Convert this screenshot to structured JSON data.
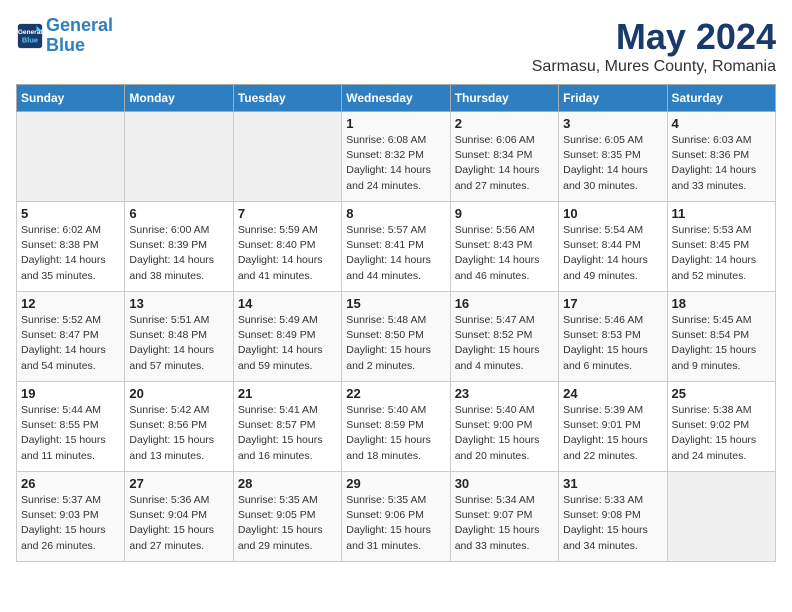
{
  "header": {
    "logo_line1": "General",
    "logo_line2": "Blue",
    "main_title": "May 2024",
    "subtitle": "Sarmasu, Mures County, Romania"
  },
  "weekdays": [
    "Sunday",
    "Monday",
    "Tuesday",
    "Wednesday",
    "Thursday",
    "Friday",
    "Saturday"
  ],
  "weeks": [
    [
      {
        "day": "",
        "detail": ""
      },
      {
        "day": "",
        "detail": ""
      },
      {
        "day": "",
        "detail": ""
      },
      {
        "day": "1",
        "detail": "Sunrise: 6:08 AM\nSunset: 8:32 PM\nDaylight: 14 hours\nand 24 minutes."
      },
      {
        "day": "2",
        "detail": "Sunrise: 6:06 AM\nSunset: 8:34 PM\nDaylight: 14 hours\nand 27 minutes."
      },
      {
        "day": "3",
        "detail": "Sunrise: 6:05 AM\nSunset: 8:35 PM\nDaylight: 14 hours\nand 30 minutes."
      },
      {
        "day": "4",
        "detail": "Sunrise: 6:03 AM\nSunset: 8:36 PM\nDaylight: 14 hours\nand 33 minutes."
      }
    ],
    [
      {
        "day": "5",
        "detail": "Sunrise: 6:02 AM\nSunset: 8:38 PM\nDaylight: 14 hours\nand 35 minutes."
      },
      {
        "day": "6",
        "detail": "Sunrise: 6:00 AM\nSunset: 8:39 PM\nDaylight: 14 hours\nand 38 minutes."
      },
      {
        "day": "7",
        "detail": "Sunrise: 5:59 AM\nSunset: 8:40 PM\nDaylight: 14 hours\nand 41 minutes."
      },
      {
        "day": "8",
        "detail": "Sunrise: 5:57 AM\nSunset: 8:41 PM\nDaylight: 14 hours\nand 44 minutes."
      },
      {
        "day": "9",
        "detail": "Sunrise: 5:56 AM\nSunset: 8:43 PM\nDaylight: 14 hours\nand 46 minutes."
      },
      {
        "day": "10",
        "detail": "Sunrise: 5:54 AM\nSunset: 8:44 PM\nDaylight: 14 hours\nand 49 minutes."
      },
      {
        "day": "11",
        "detail": "Sunrise: 5:53 AM\nSunset: 8:45 PM\nDaylight: 14 hours\nand 52 minutes."
      }
    ],
    [
      {
        "day": "12",
        "detail": "Sunrise: 5:52 AM\nSunset: 8:47 PM\nDaylight: 14 hours\nand 54 minutes."
      },
      {
        "day": "13",
        "detail": "Sunrise: 5:51 AM\nSunset: 8:48 PM\nDaylight: 14 hours\nand 57 minutes."
      },
      {
        "day": "14",
        "detail": "Sunrise: 5:49 AM\nSunset: 8:49 PM\nDaylight: 14 hours\nand 59 minutes."
      },
      {
        "day": "15",
        "detail": "Sunrise: 5:48 AM\nSunset: 8:50 PM\nDaylight: 15 hours\nand 2 minutes."
      },
      {
        "day": "16",
        "detail": "Sunrise: 5:47 AM\nSunset: 8:52 PM\nDaylight: 15 hours\nand 4 minutes."
      },
      {
        "day": "17",
        "detail": "Sunrise: 5:46 AM\nSunset: 8:53 PM\nDaylight: 15 hours\nand 6 minutes."
      },
      {
        "day": "18",
        "detail": "Sunrise: 5:45 AM\nSunset: 8:54 PM\nDaylight: 15 hours\nand 9 minutes."
      }
    ],
    [
      {
        "day": "19",
        "detail": "Sunrise: 5:44 AM\nSunset: 8:55 PM\nDaylight: 15 hours\nand 11 minutes."
      },
      {
        "day": "20",
        "detail": "Sunrise: 5:42 AM\nSunset: 8:56 PM\nDaylight: 15 hours\nand 13 minutes."
      },
      {
        "day": "21",
        "detail": "Sunrise: 5:41 AM\nSunset: 8:57 PM\nDaylight: 15 hours\nand 16 minutes."
      },
      {
        "day": "22",
        "detail": "Sunrise: 5:40 AM\nSunset: 8:59 PM\nDaylight: 15 hours\nand 18 minutes."
      },
      {
        "day": "23",
        "detail": "Sunrise: 5:40 AM\nSunset: 9:00 PM\nDaylight: 15 hours\nand 20 minutes."
      },
      {
        "day": "24",
        "detail": "Sunrise: 5:39 AM\nSunset: 9:01 PM\nDaylight: 15 hours\nand 22 minutes."
      },
      {
        "day": "25",
        "detail": "Sunrise: 5:38 AM\nSunset: 9:02 PM\nDaylight: 15 hours\nand 24 minutes."
      }
    ],
    [
      {
        "day": "26",
        "detail": "Sunrise: 5:37 AM\nSunset: 9:03 PM\nDaylight: 15 hours\nand 26 minutes."
      },
      {
        "day": "27",
        "detail": "Sunrise: 5:36 AM\nSunset: 9:04 PM\nDaylight: 15 hours\nand 27 minutes."
      },
      {
        "day": "28",
        "detail": "Sunrise: 5:35 AM\nSunset: 9:05 PM\nDaylight: 15 hours\nand 29 minutes."
      },
      {
        "day": "29",
        "detail": "Sunrise: 5:35 AM\nSunset: 9:06 PM\nDaylight: 15 hours\nand 31 minutes."
      },
      {
        "day": "30",
        "detail": "Sunrise: 5:34 AM\nSunset: 9:07 PM\nDaylight: 15 hours\nand 33 minutes."
      },
      {
        "day": "31",
        "detail": "Sunrise: 5:33 AM\nSunset: 9:08 PM\nDaylight: 15 hours\nand 34 minutes."
      },
      {
        "day": "",
        "detail": ""
      }
    ]
  ]
}
